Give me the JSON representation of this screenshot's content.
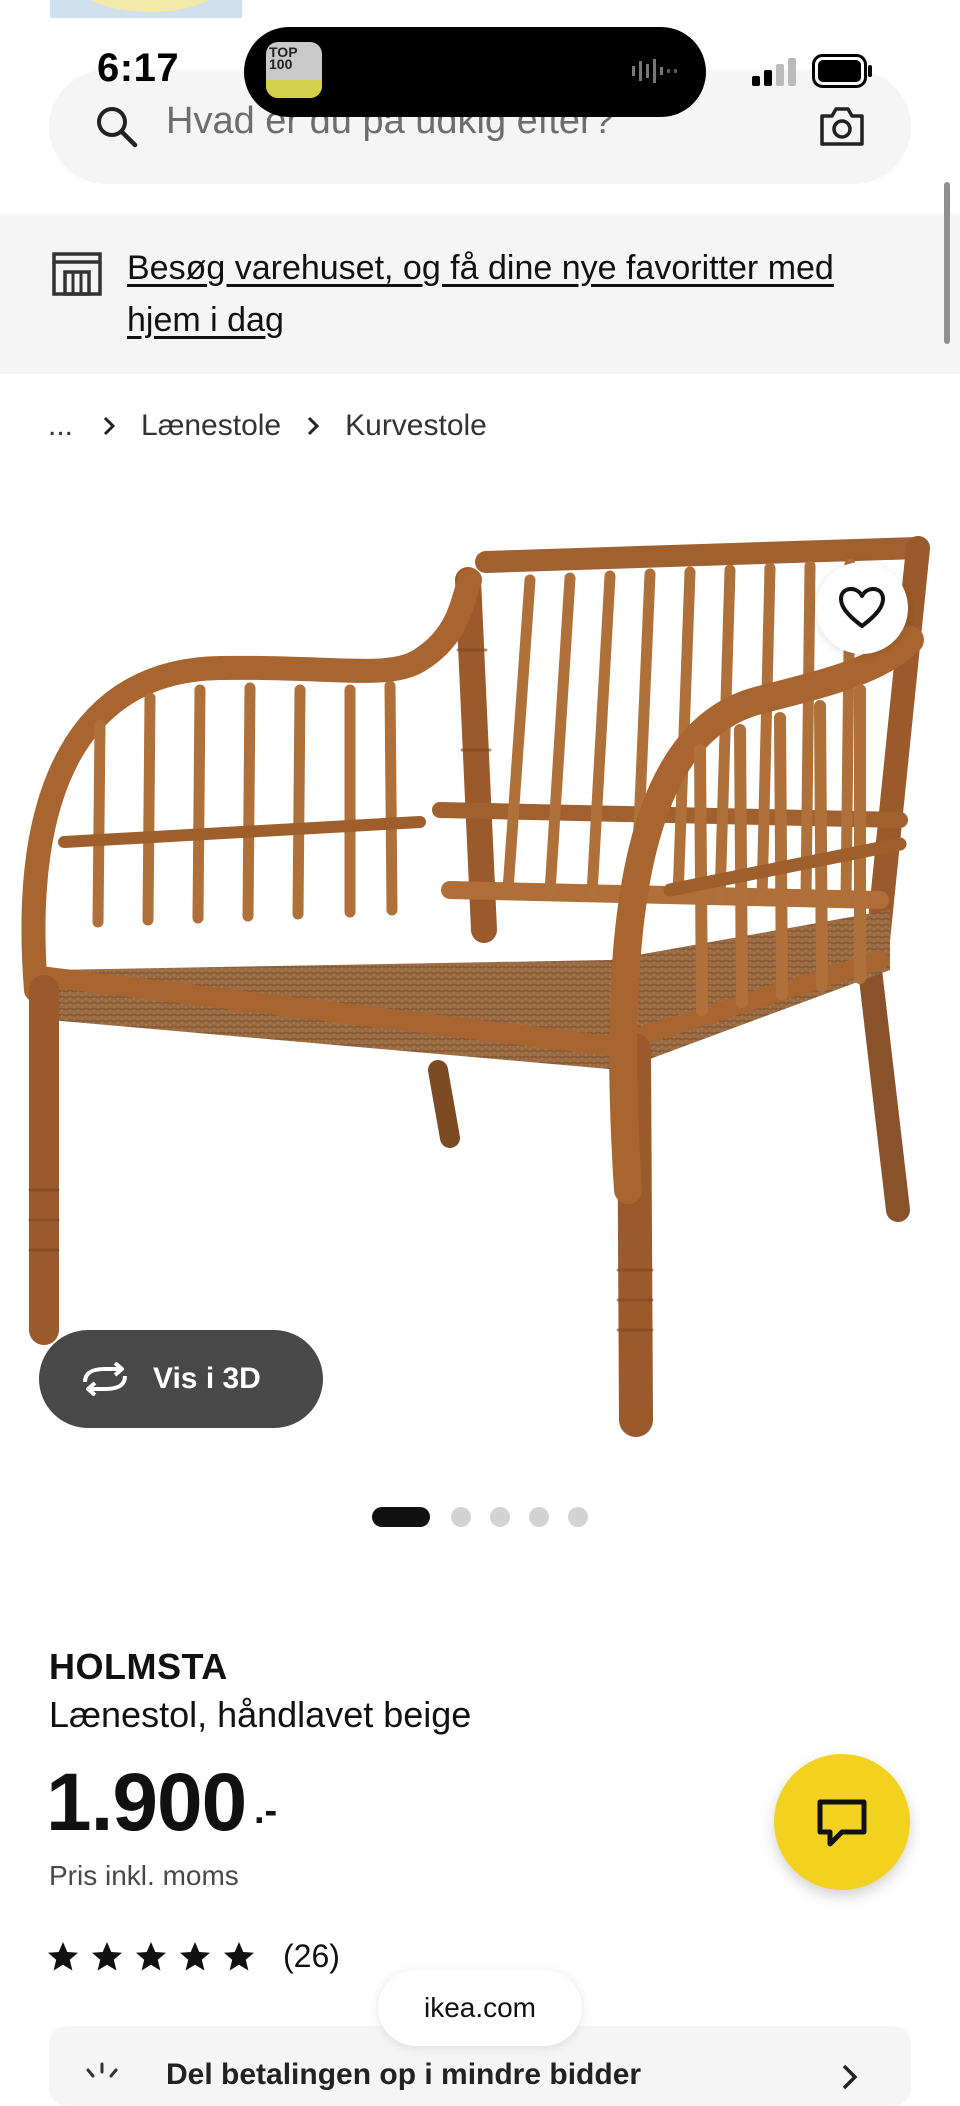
{
  "status_bar": {
    "time": "6:17",
    "island_app_badge": "TOP 100"
  },
  "search": {
    "placeholder": "Hvad er du på udkig efter?"
  },
  "store_banner": {
    "text": "Besøg varehuset, og få dine nye favoritter med hjem i dag"
  },
  "breadcrumb": {
    "items": [
      "...",
      "Lænestole",
      "Kurvestole"
    ]
  },
  "product": {
    "view_3d_label": "Vis i 3D",
    "image_count": 5,
    "active_image_index": 0,
    "name": "HOLMSTA",
    "description": "Lænestol, håndlavet beige",
    "price": "1.900",
    "price_suffix": ".-",
    "price_note": "Pris inkl. moms",
    "rating_stars": 5,
    "review_count": "(26)"
  },
  "promo": {
    "text": "Del betalingen op i mindre bidder"
  },
  "browser": {
    "url": "ikea.com"
  },
  "colors": {
    "accent_yellow": "#f2d21f",
    "rattan": "#a8652f",
    "dark_button": "#484848"
  },
  "icons": [
    "search-icon",
    "camera-icon",
    "store-icon",
    "chevron-right-icon",
    "heart-icon",
    "rotate-3d-icon",
    "star-icon",
    "chat-icon"
  ]
}
